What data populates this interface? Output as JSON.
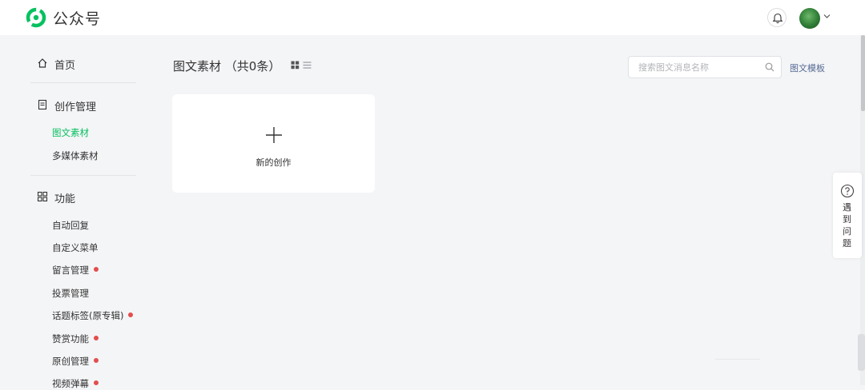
{
  "header": {
    "app_title": "公众号"
  },
  "sidebar": {
    "home_label": "首页",
    "creation_group_label": "创作管理",
    "creation_items": [
      {
        "label": "图文素材"
      },
      {
        "label": "多媒体素材"
      }
    ],
    "feature_group_label": "功能",
    "feature_items": [
      {
        "label": "自动回复"
      },
      {
        "label": "自定义菜单"
      },
      {
        "label": "留言管理"
      },
      {
        "label": "投票管理"
      },
      {
        "label": "话题标签(原专辑)"
      },
      {
        "label": "赞赏功能"
      },
      {
        "label": "原创管理"
      },
      {
        "label": "视频弹幕"
      }
    ]
  },
  "main": {
    "title": "图文素材",
    "count_text": "（共0条）",
    "search_placeholder": "搜索图文消息名称",
    "template_link": "图文模板",
    "new_card_label": "新的创作"
  },
  "help": {
    "label": "遇到问题"
  },
  "colors": {
    "brand_green": "#07c160",
    "link_blue": "#576b95",
    "alert_red": "#e34d4d"
  }
}
